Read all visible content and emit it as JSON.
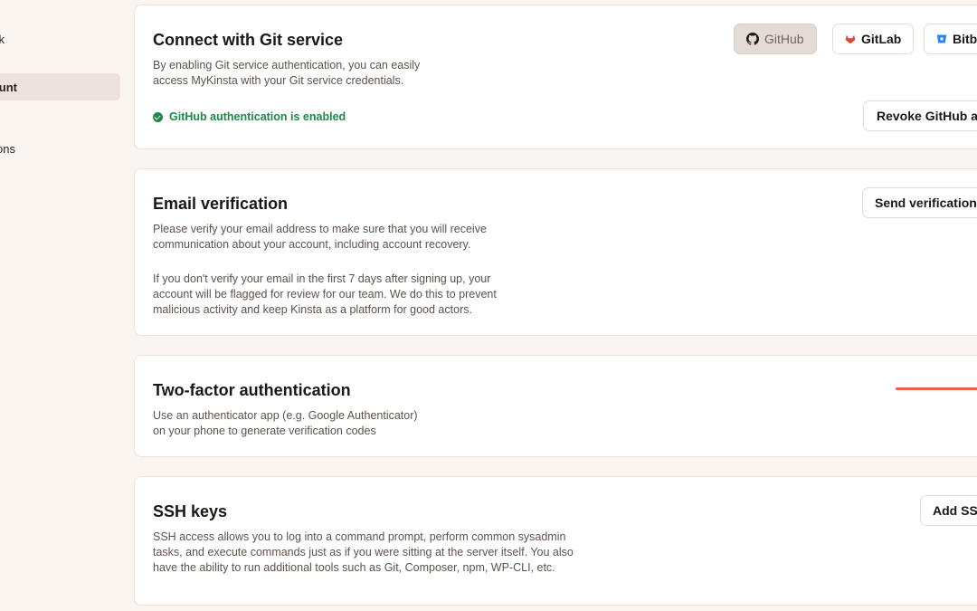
{
  "sidebar": {
    "items": [
      {
        "label": "k"
      },
      {
        "label": "unt"
      },
      {
        "label": "ions"
      }
    ]
  },
  "git": {
    "title": "Connect with Git service",
    "description_line1": "By enabling Git service authentication, you can easily",
    "description_line2": "access MyKinsta with your Git service credentials.",
    "providers": [
      {
        "label": "GitHub",
        "icon": "github-icon",
        "selected": true
      },
      {
        "label": "GitLab",
        "icon": "gitlab-icon",
        "color": "#e24329"
      },
      {
        "label": "Bitbu",
        "icon": "bitbucket-icon",
        "color": "#2684ff"
      }
    ],
    "status": "GitHub authentication is enabled",
    "revoke_label": "Revoke GitHub ac"
  },
  "email": {
    "title": "Email verification",
    "para1_line1": "Please verify your email address to make sure that you will receive",
    "para1_line2": "communication about your account, including account recovery.",
    "para2_line1": "If you don't verify your email in the first 7 days after signing up, your",
    "para2_line2": "account will be flagged for review for our team. We do this to prevent",
    "para2_line3": "malicious activity and keep Kinsta as a platform for good actors.",
    "button_label": "Send verification"
  },
  "twofa": {
    "title": "Two-factor authentication",
    "line1": "Use an authenticator app (e.g. Google Authenticator)",
    "line2": "on your phone to generate verification codes"
  },
  "ssh": {
    "title": "SSH keys",
    "line1": "SSH access allows you to log into a command prompt, perform common sysadmin",
    "line2": "tasks, and execute commands just as if you were sitting at the server itself. You also",
    "line3": "have the ability to run additional tools such as Git, Composer, npm, WP-CLI, etc.",
    "button_label": "Add SSH"
  },
  "colors": {
    "accent": "#ee5c4c",
    "success": "#1a8a45",
    "background": "#fbf5f1"
  }
}
